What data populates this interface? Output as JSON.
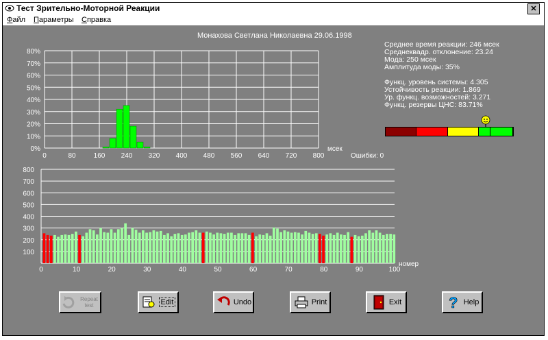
{
  "window": {
    "title": "Тест Зрительно-Моторной Реакции",
    "close_label": "✕"
  },
  "menu": [
    {
      "label": "Файл",
      "ul": "Ф",
      "rest": "айл"
    },
    {
      "label": "Параметры",
      "ul": "П",
      "rest": "араметры"
    },
    {
      "label": "Справка",
      "ul": "С",
      "rest": "правка"
    }
  ],
  "header": {
    "subject": "Монахова Светлана Николаевна 29.06.1998"
  },
  "stats": {
    "mean": "Среднее время реакции: 246 мсек",
    "sd": "Среднекв​адр. отклонение: 23.24",
    "mode": "Мода: 250 мсек",
    "mode_amp": "Амплитуда моды: 35%",
    "func_level": "Функц. уровень системы: 4.305",
    "stability": "Устойчивость реакции: 1.869",
    "capabilities": "Ур. функц. возможностей: 3.271",
    "reserves": "Функц. резервы ЦНС: 83.71%"
  },
  "scale": {
    "segments": [
      "#8b0000",
      "#ff0000",
      "#ffff00",
      "#00ff00",
      "#00ff00"
    ],
    "marker_value": 0.83
  },
  "histogram": {
    "unit": "мсек",
    "errors_label": "Ошибки: 0",
    "ylim": [
      0,
      80
    ],
    "xlim": [
      0,
      800
    ],
    "y_ticks": [
      "0%",
      "10%",
      "20%",
      "30%",
      "40%",
      "50%",
      "60%",
      "70%",
      "80%"
    ],
    "x_ticks": [
      "0",
      "80",
      "160",
      "240",
      "320",
      "400",
      "480",
      "560",
      "640",
      "720",
      "800"
    ]
  },
  "series_chart": {
    "xlabel": "номер",
    "ylim": [
      0,
      800
    ],
    "y_ticks": [
      "0",
      "100",
      "200",
      "300",
      "400",
      "500",
      "600",
      "700",
      "800"
    ],
    "x_ticks": [
      "0",
      "10",
      "20",
      "30",
      "40",
      "50",
      "60",
      "70",
      "80",
      "90",
      "100"
    ]
  },
  "chart_data": [
    {
      "type": "bar",
      "title": "",
      "xlabel": "мсек",
      "ylabel": "",
      "x": [
        180,
        200,
        220,
        240,
        260,
        280,
        300
      ],
      "values": [
        1,
        8,
        32,
        35,
        18,
        5,
        1
      ],
      "ylim": [
        0,
        80
      ],
      "xlim": [
        0,
        800
      ],
      "grid": true
    },
    {
      "type": "bar",
      "title": "",
      "xlabel": "номер",
      "ylabel": "",
      "ylim": [
        0,
        800
      ],
      "xlim": [
        0,
        100
      ],
      "grid": true,
      "values": [
        255,
        240,
        235,
        240,
        225,
        240,
        245,
        240,
        250,
        270,
        240,
        230,
        260,
        290,
        280,
        245,
        300,
        265,
        260,
        290,
        260,
        290,
        300,
        340,
        240,
        300,
        285,
        260,
        280,
        260,
        265,
        280,
        270,
        275,
        240,
        255,
        230,
        250,
        255,
        240,
        245,
        260,
        265,
        280,
        260,
        260,
        270,
        260,
        245,
        260,
        255,
        250,
        260,
        260,
        240,
        255,
        255,
        255,
        240,
        260,
        230,
        245,
        240,
        255,
        235,
        305,
        295,
        265,
        280,
        270,
        260,
        265,
        260,
        245,
        275,
        260,
        250,
        255,
        250,
        235,
        245,
        255,
        240,
        260,
        245,
        240,
        265,
        225,
        240,
        230,
        235,
        255,
        280,
        260,
        280,
        260,
        240,
        250,
        250,
        245
      ],
      "highlight": [
        1,
        2,
        3,
        11,
        46,
        60,
        79,
        80,
        88
      ]
    }
  ],
  "buttons": {
    "repeat": "Repeat test",
    "edit": "Edit",
    "undo": "Undo",
    "print": "Print",
    "exit": "Exit",
    "help": "Help"
  }
}
